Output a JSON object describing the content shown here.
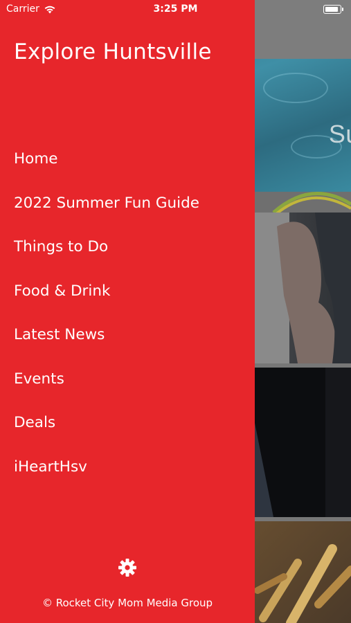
{
  "status_bar": {
    "carrier": "Carrier",
    "time": "3:25 PM"
  },
  "drawer": {
    "title": "Explore Huntsville",
    "background_color": "#e7262b",
    "menu_items": [
      {
        "label": "Home"
      },
      {
        "label": "2022 Summer Fun Guide"
      },
      {
        "label": "Things to Do"
      },
      {
        "label": "Food & Drink"
      },
      {
        "label": "Latest News"
      },
      {
        "label": "Events"
      },
      {
        "label": "Deals"
      },
      {
        "label": "iHeartHsv"
      }
    ],
    "settings_icon": "gear-icon",
    "copyright": "© Rocket City Mom Media Group"
  },
  "background_content": {
    "card1_title": "Summer Fun Guide"
  }
}
